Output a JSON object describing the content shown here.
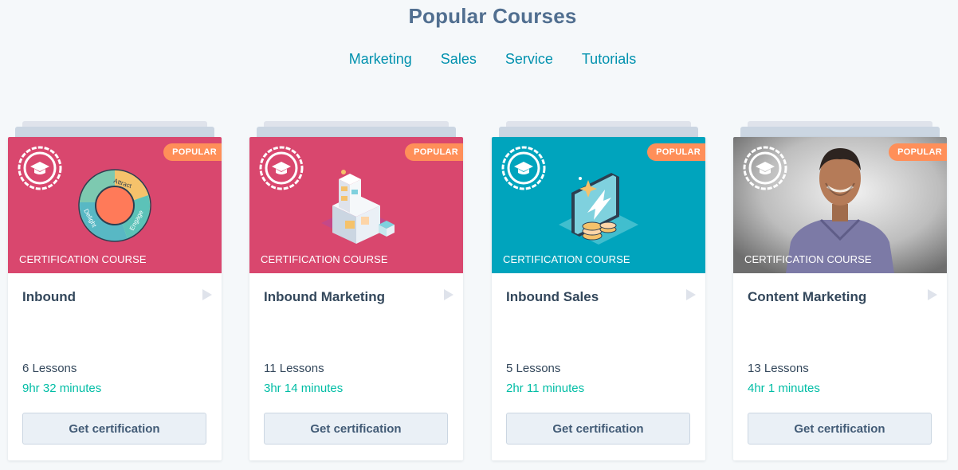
{
  "header": {
    "title": "Popular Courses"
  },
  "tabs": [
    "Marketing",
    "Sales",
    "Service",
    "Tutorials"
  ],
  "course_cards": [
    {
      "badge": "POPULAR",
      "type_label": "CERTIFICATION COURSE",
      "title": "Inbound",
      "lessons": "6 Lessons",
      "duration": "9hr 32 minutes",
      "button_label": "Get certification",
      "banner_color": "#d9476e",
      "illustration_text": [
        "Attract",
        "Engage",
        "Delight"
      ]
    },
    {
      "badge": "POPULAR",
      "type_label": "CERTIFICATION COURSE",
      "title": "Inbound Marketing",
      "lessons": "11 Lessons",
      "duration": "3hr 14 minutes",
      "button_label": "Get certification",
      "banner_color": "#d9476e"
    },
    {
      "badge": "POPULAR",
      "type_label": "CERTIFICATION COURSE",
      "title": "Inbound Sales",
      "lessons": "5 Lessons",
      "duration": "2hr 11 minutes",
      "button_label": "Get certification",
      "banner_color": "#00a4bd"
    },
    {
      "badge": "POPULAR",
      "type_label": "CERTIFICATION COURSE",
      "title": "Content Marketing",
      "lessons": "13 Lessons",
      "duration": "4hr 1 minutes",
      "button_label": "Get certification",
      "banner_color": "#9a9a9a"
    }
  ],
  "icons": [
    "graduation-cap-badge-icon",
    "play-icon"
  ],
  "colors": {
    "accent_teal": "#00bda5",
    "link": "#0091ae",
    "pill": "#ff8f59"
  }
}
